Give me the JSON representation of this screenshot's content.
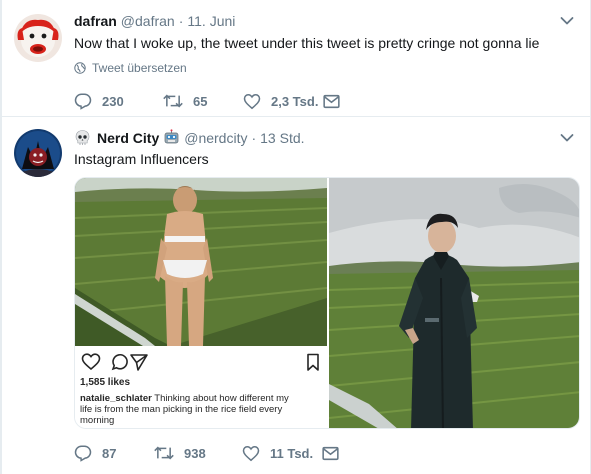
{
  "tweets": [
    {
      "fullname": "dafran",
      "handle": "@dafran",
      "time": "11. Juni",
      "text": "Now that I woke up, the tweet under this tweet is pretty cringe not gonna lie",
      "translate_label": "Tweet übersetzen",
      "replies": "230",
      "retweets": "65",
      "likes": "2,3 Tsd."
    },
    {
      "fullname": "Nerd City",
      "handle": "@nerdcity",
      "time": "13 Std.",
      "text": "Instagram Influencers",
      "replies": "87",
      "retweets": "938",
      "likes": "11 Tsd.",
      "instagram": {
        "likes": "1,585 likes",
        "username": "natalie_schlater",
        "caption": "Thinking about how different my life is from the man picking in the rice field every morning"
      }
    }
  ],
  "icons": {
    "reply": "reply-icon",
    "retweet": "retweet-icon",
    "like": "heart-icon",
    "dm": "envelope-icon",
    "caret": "chevron-down-icon",
    "globe": "globe-icon"
  },
  "colors": {
    "text": "#14171a",
    "secondary": "#657786",
    "divider": "#e6ecf0",
    "background": "#e6ecf0"
  }
}
